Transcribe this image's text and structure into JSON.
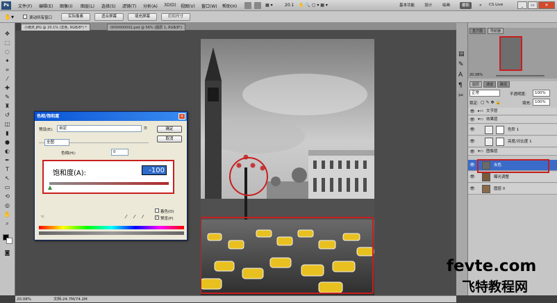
{
  "menubar": {
    "app_icon": "Ps",
    "items": [
      "文件(F)",
      "编辑(E)",
      "图像(I)",
      "图层(L)",
      "选择(S)",
      "滤镜(T)",
      "分析(A)",
      "3D(D)",
      "视图(V)",
      "窗口(W)",
      "帮助(H)"
    ],
    "zoom": "20.1",
    "workspaces": [
      "基本功能",
      "设计",
      "绘画",
      "摄影"
    ],
    "cslive": "CS Live"
  },
  "options": {
    "checkbox_label": "滚动所有窗口",
    "buttons": [
      "实际像素",
      "适合屏幕",
      "填充屏幕",
      "打印尺寸"
    ]
  },
  "tabs": [
    {
      "label": "小雨天.JPG @ 20.1% (去色, RGB/8*) *"
    },
    {
      "label": "0000000001.psd @ 56% (图层 1, RGB/8*)"
    }
  ],
  "dialog": {
    "title": "色相/饱和度",
    "preset_label": "预设(E):",
    "preset_value": "自定",
    "channel_value": "全图",
    "hue_label": "色相(H):",
    "hue_value": "0",
    "ok_label": "确定",
    "cancel_label": "取消",
    "colorize_label": "着色(O)",
    "preview_label": "预览(P)",
    "saturation_label": "饱和度(A):",
    "saturation_value": "-100"
  },
  "right_panel": {
    "nav_tabs": [
      "直方图",
      "导航器"
    ],
    "nav_zoom": "20.08%",
    "layer_tabs": [
      "图层",
      "通道",
      "路径"
    ],
    "blend_mode": "正常",
    "opacity_label": "不透明度:",
    "opacity_value": "100%",
    "lock_label": "锁定:",
    "fill_label": "填充:",
    "fill_value": "100%",
    "layers": [
      {
        "name": "文字层",
        "type": "group"
      },
      {
        "name": "效果层",
        "type": "group"
      },
      {
        "name": "色阶 1",
        "type": "adjust"
      },
      {
        "name": "亮度/对比度 1",
        "type": "adjust"
      },
      {
        "name": "图像层",
        "type": "group"
      },
      {
        "name": "去色",
        "type": "layer",
        "selected": true
      },
      {
        "name": "曝光调整",
        "type": "layer"
      },
      {
        "name": "图层 0",
        "type": "layer"
      }
    ]
  },
  "status": {
    "zoom": "20.08%",
    "doc": "文档:24.7M/74.2M"
  },
  "watermark": {
    "line1": "fevte.com",
    "line2": "飞特教程网"
  }
}
